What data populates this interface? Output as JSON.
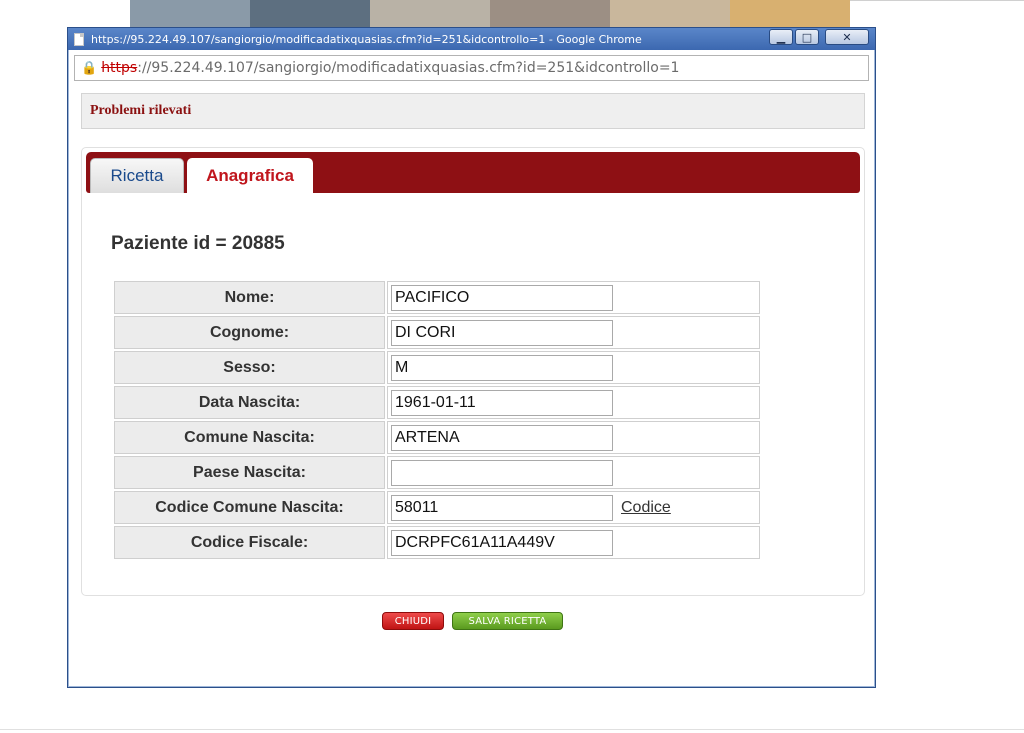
{
  "window": {
    "title": "https://95.224.49.107/sangiorgio/modificadatixquasias.cfm?id=251&idcontrollo=1 - Google Chrome",
    "controls": {
      "minimize": "▁",
      "maximize": "□",
      "close": "✕"
    }
  },
  "address_bar": {
    "scheme": "https",
    "url_rest": "://95.224.49.107/sangiorgio/modificadatixquasias.cfm?id=251&idcontrollo=1"
  },
  "problems": {
    "title": "Problemi rilevati"
  },
  "tabs": [
    {
      "label": "Ricetta",
      "active": false
    },
    {
      "label": "Anagrafica",
      "active": true
    }
  ],
  "patient": {
    "title": "Paziente id = 20885"
  },
  "form": {
    "rows": [
      {
        "label": "Nome:",
        "value": "PACIFICO"
      },
      {
        "label": "Cognome:",
        "value": "DI CORI"
      },
      {
        "label": "Sesso:",
        "value": "M"
      },
      {
        "label": "Data Nascita:",
        "value": "1961-01-11"
      },
      {
        "label": "Comune Nascita:",
        "value": "ARTENA"
      },
      {
        "label": "Paese Nascita:",
        "value": ""
      },
      {
        "label": "Codice Comune Nascita:",
        "value": "58011",
        "link": "Codice"
      },
      {
        "label": "Codice Fiscale:",
        "value": "DCRPFC61A11A449V"
      }
    ]
  },
  "buttons": {
    "close": "CHIUDI",
    "save": "SALVA RICETTA"
  },
  "colors": {
    "tab_bar": "#8e1014",
    "active_tab_text": "#c0161d",
    "problems_text": "#8b1111",
    "close_button": "#d42a2a",
    "save_button": "#72b134"
  }
}
